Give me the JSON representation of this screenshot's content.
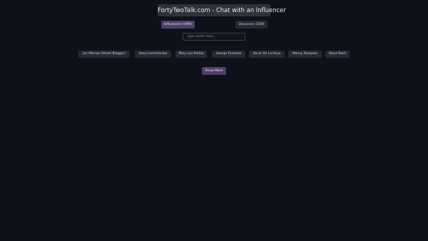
{
  "header": {
    "title": "FortyTwoTalk.com - Chat with an Influencer"
  },
  "tabs": [
    {
      "label": "Influencers (490)",
      "active": true
    },
    {
      "label": "Devoxees (569)",
      "active": false
    }
  ],
  "search": {
    "placeholder": "Type name here...",
    "value": ""
  },
  "influencers": [
    "Jan Marrow (Smart Blogger)",
    "Vasyl Lomachenko",
    "Mary Lou Retton",
    "George Foreman",
    "Oscar De La Hoya",
    "Manny Pacquiao",
    "Steve Nash"
  ],
  "actions": {
    "show_more_label": "Show More"
  },
  "colors": {
    "background": "#0f111a",
    "accent": "#4f3f6a",
    "chip": "#262833"
  }
}
